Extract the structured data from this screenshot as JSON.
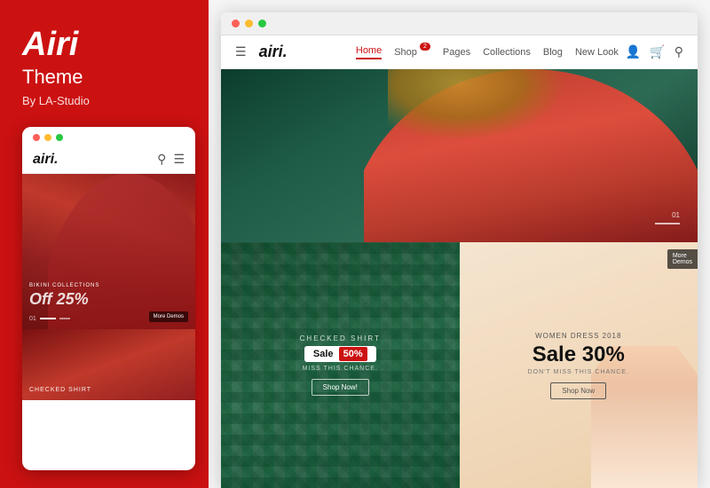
{
  "leftPanel": {
    "title": "Airi",
    "subtitle": "Theme",
    "author": "By LA-Studio",
    "mobilePreview": {
      "dots": [
        "red",
        "yellow",
        "green"
      ],
      "logo": "airi.",
      "collectionLabel": "BIKINI COLLECTIONS",
      "saleText": "Off 25%",
      "moreDemos": "More\nDemos",
      "bottomLabel": "CHECKED SHIRT"
    }
  },
  "rightPanel": {
    "desktopWindow": {
      "dots": [
        "red",
        "yellow",
        "green"
      ],
      "nav": {
        "logo": "airi.",
        "links": [
          "Home",
          "Shop",
          "Pages",
          "Collections",
          "Blog",
          "New Look"
        ],
        "activeLink": "Home",
        "shopBadge": "2"
      },
      "hero": {
        "pageNum": "01",
        "pageLabel": "—"
      },
      "gridLeft": {
        "topLabel": "CHECKED SHIRT",
        "saleLabel": "Sale",
        "salePct": "50%",
        "missText": "MISS THIS CHANCE.",
        "shopNow": "Shop Now!"
      },
      "gridRight": {
        "topLabel": "Women Dress 2018",
        "saleLabel": "Sale 30%",
        "chanceText": "DON'T MISS THIS CHANCE.",
        "shopNow": "Shop Now",
        "moreDemos": "More\nDemos"
      }
    }
  }
}
